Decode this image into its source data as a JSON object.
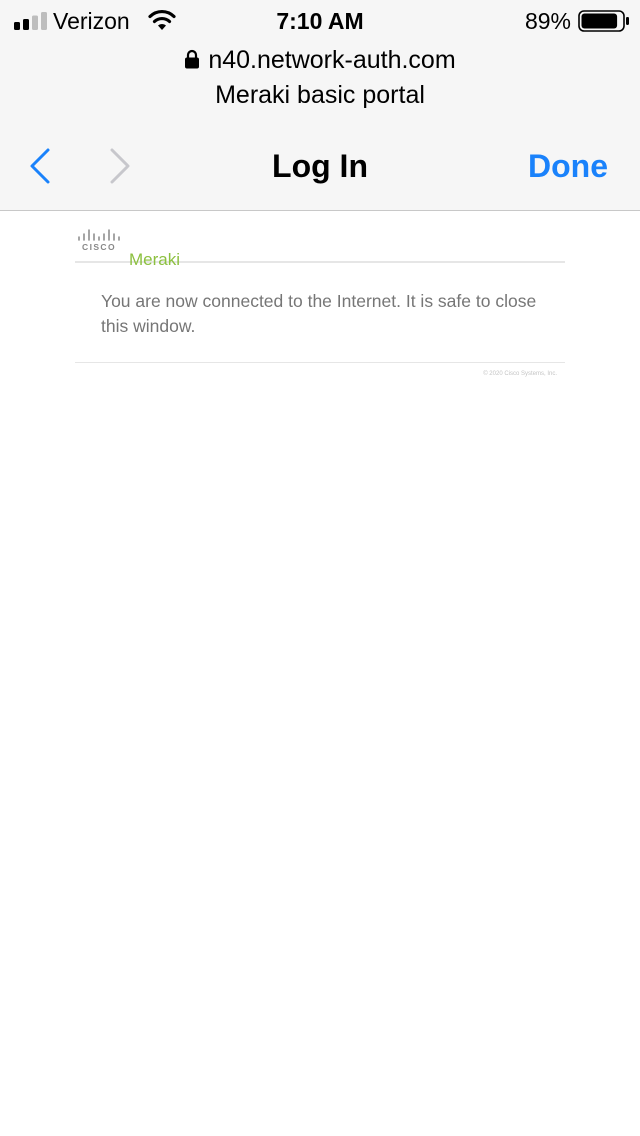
{
  "status_bar": {
    "carrier": "Verizon",
    "time": "7:10 AM",
    "battery_percent": "89%",
    "battery_level": 0.89,
    "signal_bars_active": 2,
    "signal_bars_total": 4
  },
  "browser": {
    "url": "n40.network-auth.com",
    "page_title": "Meraki basic portal",
    "nav_title": "Log In",
    "done_label": "Done"
  },
  "portal": {
    "cisco_logo_text": "CISCO",
    "brand": "Meraki",
    "message": "You are now connected to the Internet. It is safe to close this window.",
    "copyright": "© 2020 Cisco Systems, Inc."
  },
  "colors": {
    "accent": "#1a82fb",
    "brand_green": "#8cc03f",
    "message_text": "#767676"
  }
}
